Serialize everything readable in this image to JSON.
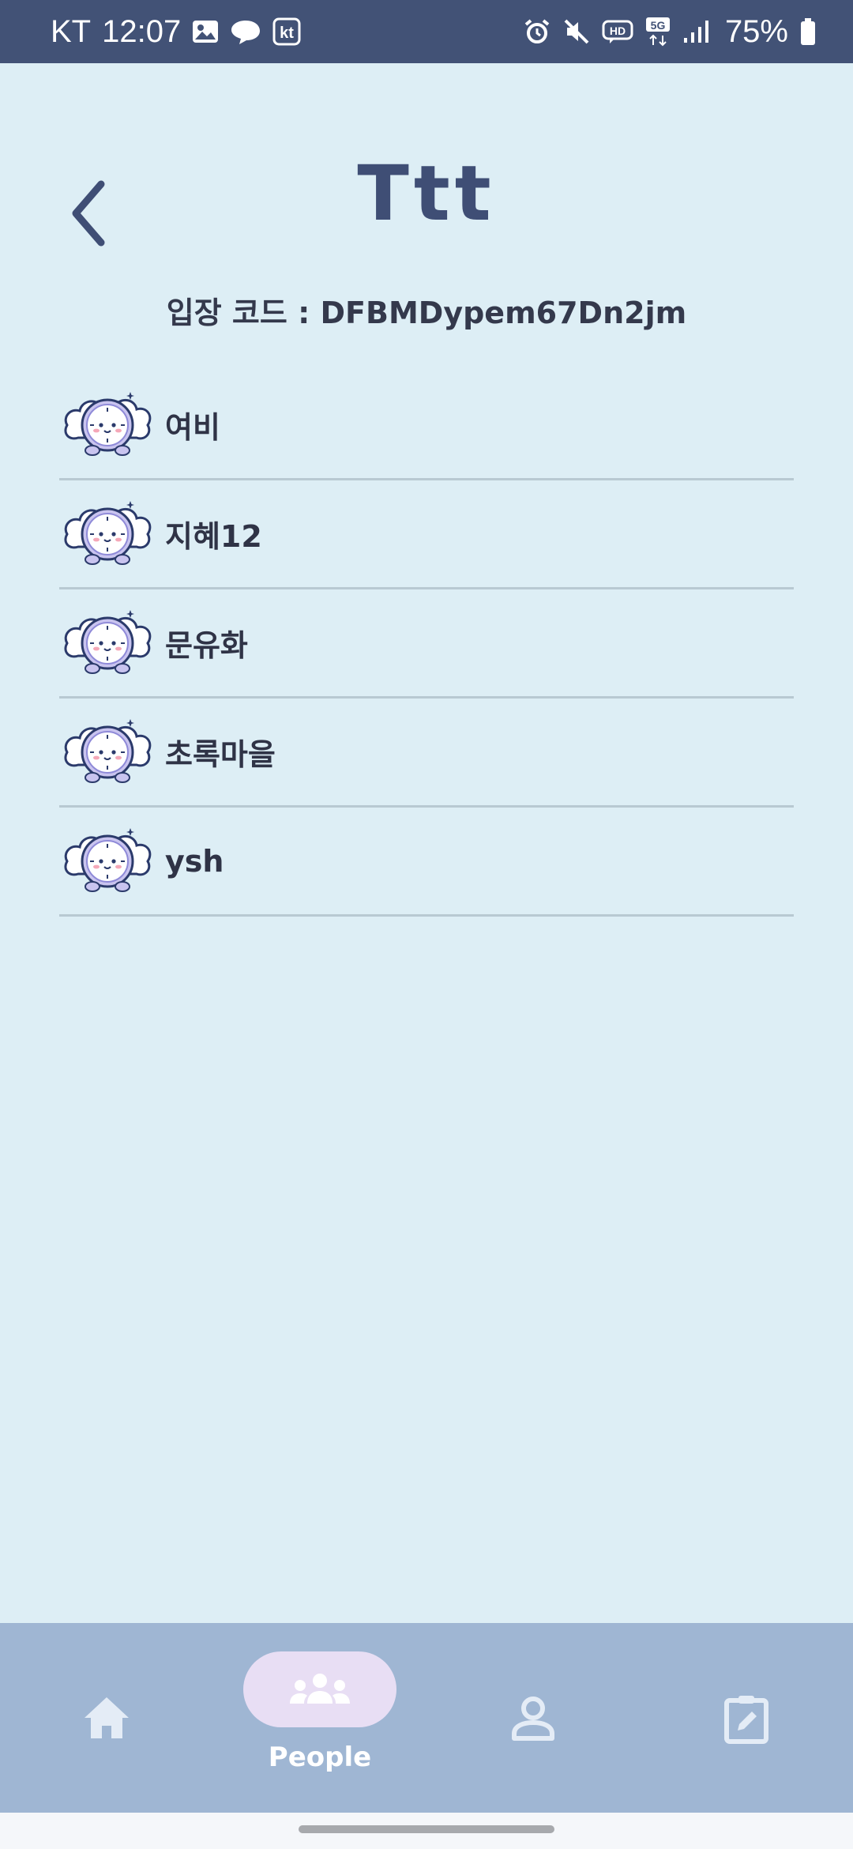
{
  "status_bar": {
    "carrier": "KT",
    "time": "12:07",
    "kt_badge": "kt",
    "hd_badge": "HD",
    "network": "5G",
    "battery": "75%"
  },
  "header": {
    "title": "Ttt",
    "entry_code_label": "입장 코드 : DFBMDypem67Dn2jm"
  },
  "members": [
    {
      "name": "여비",
      "avatar": "clock-cloud-avatar"
    },
    {
      "name": "지혜12",
      "avatar": "clock-cloud-avatar"
    },
    {
      "name": "문유화",
      "avatar": "clock-cloud-avatar"
    },
    {
      "name": "초록마을",
      "avatar": "clock-cloud-avatar"
    },
    {
      "name": "ysh",
      "avatar": "clock-cloud-avatar"
    }
  ],
  "bottom_nav": {
    "items": [
      {
        "icon": "home-icon",
        "label": ""
      },
      {
        "icon": "people-icon",
        "label": "People",
        "active": true
      },
      {
        "icon": "person-icon",
        "label": ""
      },
      {
        "icon": "edit-note-icon",
        "label": ""
      }
    ]
  },
  "colors": {
    "status_bar": "#425276",
    "background": "#ddeef5",
    "title": "#3f4e75",
    "bottom_nav": "#9fb6d3",
    "active_pill": "#e8def4"
  }
}
